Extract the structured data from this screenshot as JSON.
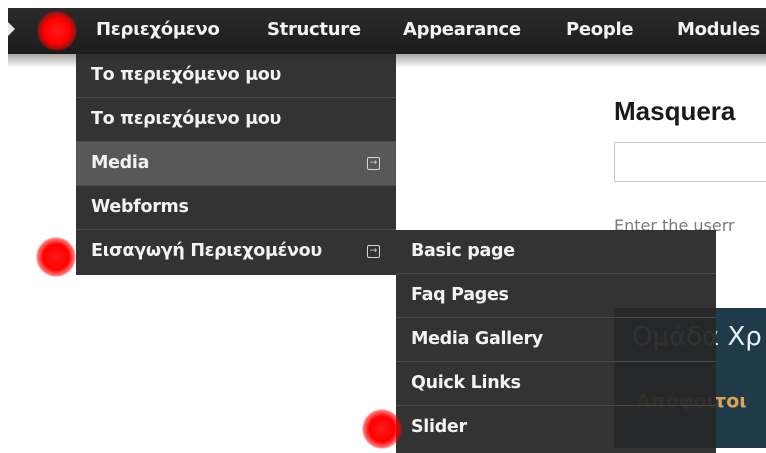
{
  "toolbar": {
    "items": [
      {
        "label": "Περιεχόμενο"
      },
      {
        "label": "Structure"
      },
      {
        "label": "Appearance"
      },
      {
        "label": "People"
      },
      {
        "label": "Modules"
      }
    ]
  },
  "content_menu": {
    "items": [
      {
        "label": "Το περιεχόμενο μου"
      },
      {
        "label": "Το περιεχόμενο μου"
      },
      {
        "label": "Media",
        "has_submenu": true,
        "active": true
      },
      {
        "label": "Webforms"
      },
      {
        "label": "Εισαγωγή Περιεχομένου",
        "has_submenu": true
      }
    ]
  },
  "add_content_menu": {
    "items": [
      {
        "label": "Basic page"
      },
      {
        "label": "Faq Pages"
      },
      {
        "label": "Media Gallery"
      },
      {
        "label": "Quick Links"
      },
      {
        "label": "Slider"
      }
    ]
  },
  "page": {
    "title": "Masquera",
    "help_text": "Enter the userr",
    "team_title": "Ομάδα Χρ",
    "team_link": "Απόφοιτοι"
  },
  "colors": {
    "toolbar_bg": "#1c1c1c",
    "menu_bg": "#262626",
    "menu_active_bg": "#585858",
    "marker": "#ff0000",
    "team_block_bg": "#1f3b4a",
    "team_link": "#e0a255"
  }
}
